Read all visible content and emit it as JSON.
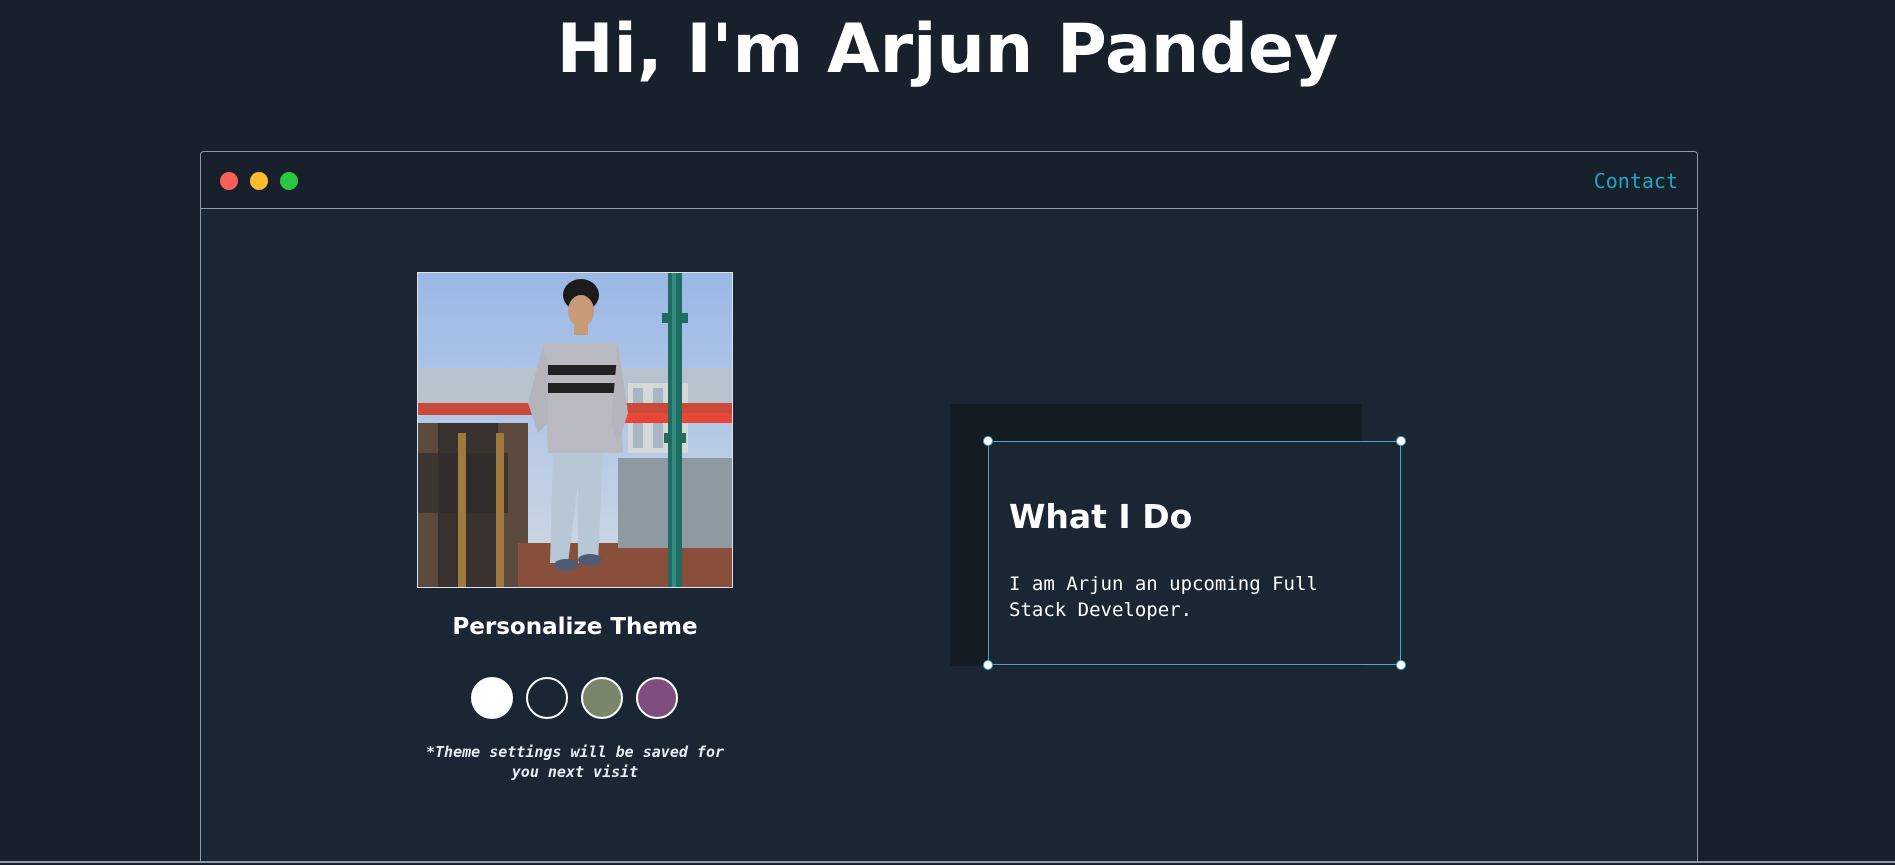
{
  "header": {
    "title": "Hi, I'm Arjun Pandey"
  },
  "window": {
    "controls": [
      "close",
      "minimize",
      "maximize"
    ],
    "nav": {
      "contact_label": "Contact"
    }
  },
  "profile": {
    "photo_alt": "Arjun Pandey"
  },
  "theme": {
    "heading": "Personalize Theme",
    "swatches": [
      {
        "name": "light",
        "color": "#ffffff"
      },
      {
        "name": "dark",
        "color": "#1b2634"
      },
      {
        "name": "green",
        "color": "#78866b"
      },
      {
        "name": "purple",
        "color": "#7f4d7e"
      }
    ],
    "note": "*Theme settings will be saved for you next visit"
  },
  "intro_card": {
    "title": "What I Do",
    "text": "I am Arjun an upcoming Full Stack Developer."
  },
  "colors": {
    "background": "#17202b",
    "panel": "#1b2634",
    "accent": "#1fa6c5",
    "border": "#8e9aa8"
  }
}
